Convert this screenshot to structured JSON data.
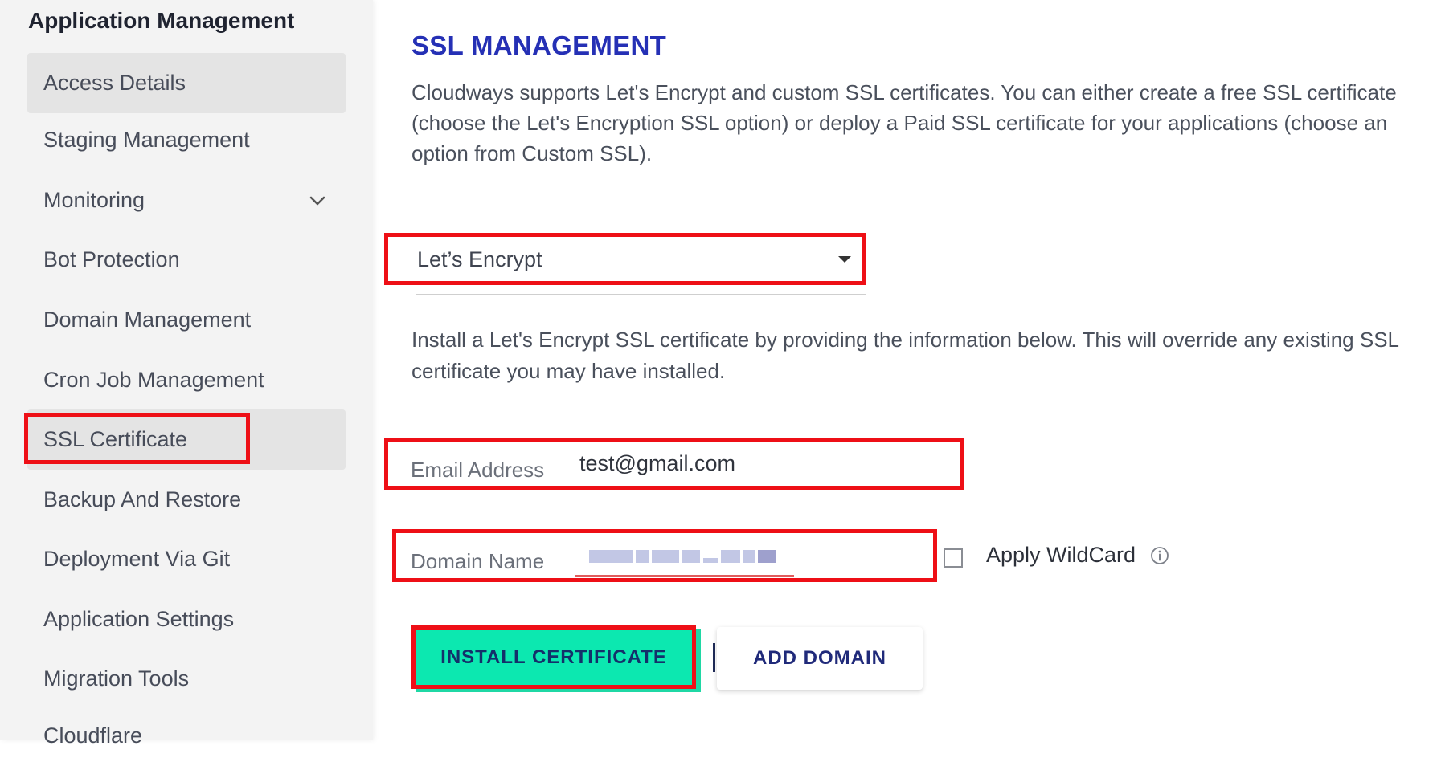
{
  "sidebar": {
    "heading": "Application Management",
    "items": [
      {
        "label": "Access Details",
        "active": true
      },
      {
        "label": "Staging Management"
      },
      {
        "label": "Monitoring",
        "icon": "chevron-down-icon"
      },
      {
        "label": "Bot Protection"
      },
      {
        "label": "Domain Management"
      },
      {
        "label": "Cron Job Management"
      },
      {
        "label": "SSL Certificate",
        "active": true,
        "highlighted": true
      },
      {
        "label": "Backup And Restore"
      },
      {
        "label": "Deployment Via Git"
      },
      {
        "label": "Application Settings"
      },
      {
        "label": "Migration Tools"
      },
      {
        "label": "Cloudflare"
      }
    ]
  },
  "main": {
    "title": "SSL MANAGEMENT",
    "description": "Cloudways supports Let's Encrypt and custom SSL certificates. You can either create a free SSL certificate (choose the Let's Encryption SSL option) or deploy a Paid SSL certificate for your applications (choose an option from Custom SSL).",
    "ssl_type": {
      "selected": "Let’s Encrypt"
    },
    "install_note": "Install a Let's Encrypt SSL certificate by providing the information below. This will override any existing SSL certificate you may have installed.",
    "email": {
      "label": "Email Address",
      "value": "test@gmail.com"
    },
    "domain": {
      "label": "Domain Name"
    },
    "wildcard": {
      "label": "Apply WildCard",
      "checked": false,
      "info_icon": "info-icon"
    },
    "buttons": {
      "install": "INSTALL CERTIFICATE",
      "add_domain": "ADD DOMAIN"
    }
  },
  "colors": {
    "highlight": "#ee0f16",
    "title": "#2530b5",
    "install_button": "#0ce8b0",
    "sidebar_bg": "#f3f3f3",
    "active_item_bg": "#e4e4e4"
  }
}
